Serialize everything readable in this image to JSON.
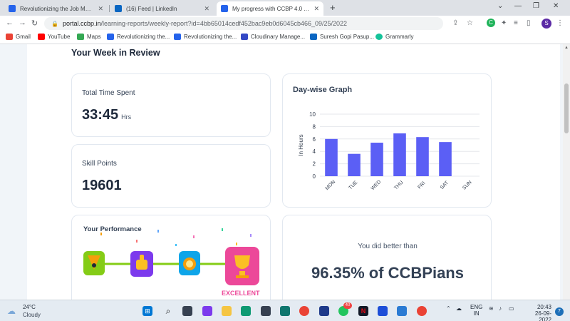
{
  "browser": {
    "tabs": [
      {
        "title": "Revolutionizing the Job Market |",
        "close": "✕",
        "favicon_color": "#2563eb"
      },
      {
        "title": "(16) Feed | LinkedIn",
        "close": "✕",
        "favicon_color": "#0a66c2"
      },
      {
        "title": "My progress with CCBP 4.0 Acad",
        "close": "✕",
        "favicon_color": "#2563eb"
      }
    ],
    "new_tab": "+",
    "window_controls": {
      "minimize": "—",
      "restore": "❐",
      "close": "✕",
      "tab_search": "⌄"
    },
    "nav": {
      "back": "←",
      "forward": "→",
      "reload": "↻"
    },
    "url": {
      "domain": "portal.ccbp.in",
      "path": "/learning-reports/weekly-report?id=4bb65014cedf452bac9eb0d6045cb466_09/25/2022"
    },
    "profile_initial": "S",
    "bookmarks": [
      {
        "label": "Gmail",
        "color": "#ea4335"
      },
      {
        "label": "YouTube",
        "color": "#ff0000"
      },
      {
        "label": "Maps",
        "color": "#34a853"
      },
      {
        "label": "Revolutionizing the...",
        "color": "#2563eb"
      },
      {
        "label": "Revolutionizing the...",
        "color": "#2563eb"
      },
      {
        "label": "Cloudinary Manage...",
        "color": "#3448c5"
      },
      {
        "label": "Suresh Gopi Pasup...",
        "color": "#0a66c2"
      },
      {
        "label": "Grammarly",
        "color": "#15c39a"
      }
    ]
  },
  "report": {
    "section_title": "Your Week in Review",
    "time_card": {
      "label": "Total Time Spent",
      "value": "33:45",
      "unit": "Hrs"
    },
    "skill_card": {
      "label": "Skill Points",
      "value": "19601"
    },
    "graph_card": {
      "title": "Day-wise Graph"
    },
    "performance_card": {
      "title": "Your Performance",
      "level": "EXCELLENT"
    },
    "comparison_card": {
      "line1": "You did better than",
      "line2": "96.35% of CCBPians"
    }
  },
  "chart_data": {
    "type": "bar",
    "categories": [
      "MON",
      "TUE",
      "WED",
      "THU",
      "FRI",
      "SAT",
      "SUN"
    ],
    "values": [
      6.0,
      3.6,
      5.4,
      6.9,
      6.3,
      5.5,
      0
    ],
    "ylabel": "In Hours",
    "xlabel": "",
    "ylim": [
      0,
      10
    ],
    "yticks": [
      0,
      2,
      4,
      6,
      8,
      10
    ],
    "bar_color": "#5b5ff5",
    "grid": true
  },
  "taskbar": {
    "weather": {
      "temp": "24°C",
      "condition": "Cloudy"
    },
    "whatsapp_badge": "40",
    "language": {
      "line1": "ENG",
      "line2": "IN"
    },
    "clock": {
      "time": "20:43",
      "date": "26-09-2022"
    },
    "notification_count": "7"
  }
}
